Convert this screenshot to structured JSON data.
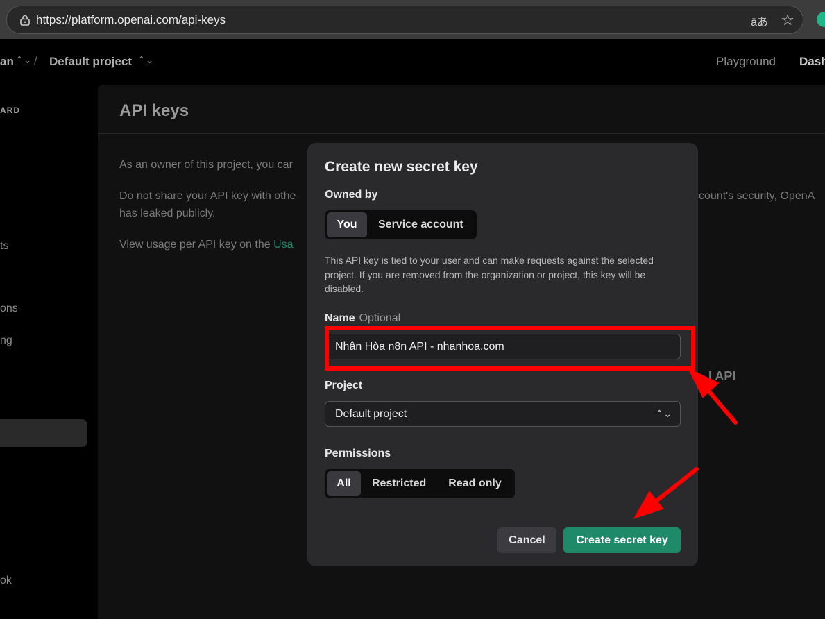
{
  "browser": {
    "url": "https://platform.openai.com/api-keys",
    "translate_glyph": "āあ"
  },
  "topnav": {
    "org": "an",
    "separator": "/",
    "project": "Default project",
    "playground": "Playground",
    "dashboard": "Dash"
  },
  "sidebar": {
    "items": [
      {
        "label": "ARD"
      },
      {
        "label": "ts"
      },
      {
        "label": "ons"
      },
      {
        "label": "ng"
      },
      {
        "label": "ok"
      }
    ]
  },
  "main": {
    "title": "API keys",
    "p1": "As an owner of this project, you car",
    "p2a": "Do not share your API key with othe",
    "p2b": "ccount's security, OpenA",
    "p3": "has leaked publicly.",
    "p4": "View usage per API key on the ",
    "p4_link": "Usa",
    "bg_api": "I API"
  },
  "modal": {
    "title": "Create new secret key",
    "owned_by_label": "Owned by",
    "owned_options": [
      "You",
      "Service account"
    ],
    "owned_selected": "You",
    "description": "This API key is tied to your user and can make requests against the selected project. If you are removed from the organization or project, this key will be disabled.",
    "name_label": "Name",
    "name_optional": "Optional",
    "name_value": "Nhân Hòa n8n API - nhanhoa.com",
    "project_label": "Project",
    "project_value": "Default project",
    "permissions_label": "Permissions",
    "permission_options": [
      "All",
      "Restricted",
      "Read only"
    ],
    "permission_selected": "All",
    "cancel": "Cancel",
    "create": "Create secret key"
  },
  "colors": {
    "accent": "#1f8a67",
    "annotation": "#ff0000"
  }
}
